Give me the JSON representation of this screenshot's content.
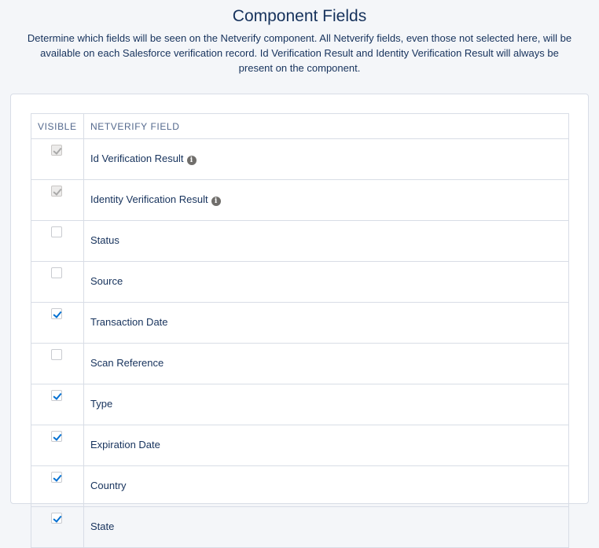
{
  "header": {
    "title": "Component Fields",
    "description": "Determine which fields will be seen on the Netverify component. All Netverify fields, even those not selected here, will be available on each Salesforce verification record. Id Verification Result and Identity Verification Result will always be present on the component."
  },
  "table": {
    "columns": [
      "VISIBLE",
      "NETVERIFY FIELD"
    ],
    "rows": [
      {
        "label": "Id Verification Result",
        "checked": true,
        "disabled": true,
        "info_icon": true
      },
      {
        "label": "Identity Verification Result",
        "checked": true,
        "disabled": true,
        "info_icon": true
      },
      {
        "label": "Status",
        "checked": false,
        "disabled": false,
        "info_icon": false
      },
      {
        "label": "Source",
        "checked": false,
        "disabled": false,
        "info_icon": false
      },
      {
        "label": "Transaction Date",
        "checked": true,
        "disabled": false,
        "info_icon": false
      },
      {
        "label": "Scan Reference",
        "checked": false,
        "disabled": false,
        "info_icon": false
      },
      {
        "label": "Type",
        "checked": true,
        "disabled": false,
        "info_icon": false
      },
      {
        "label": "Expiration Date",
        "checked": true,
        "disabled": false,
        "info_icon": false
      },
      {
        "label": "Country",
        "checked": true,
        "disabled": false,
        "info_icon": false
      },
      {
        "label": "State",
        "checked": true,
        "disabled": false,
        "info_icon": false
      }
    ]
  },
  "icons": {
    "info": "info-icon",
    "check": "checkmark-icon"
  },
  "colors": {
    "accent": "#0070d2",
    "text": "#16325c",
    "border": "#d8dde6",
    "background": "#f4f6f9"
  }
}
